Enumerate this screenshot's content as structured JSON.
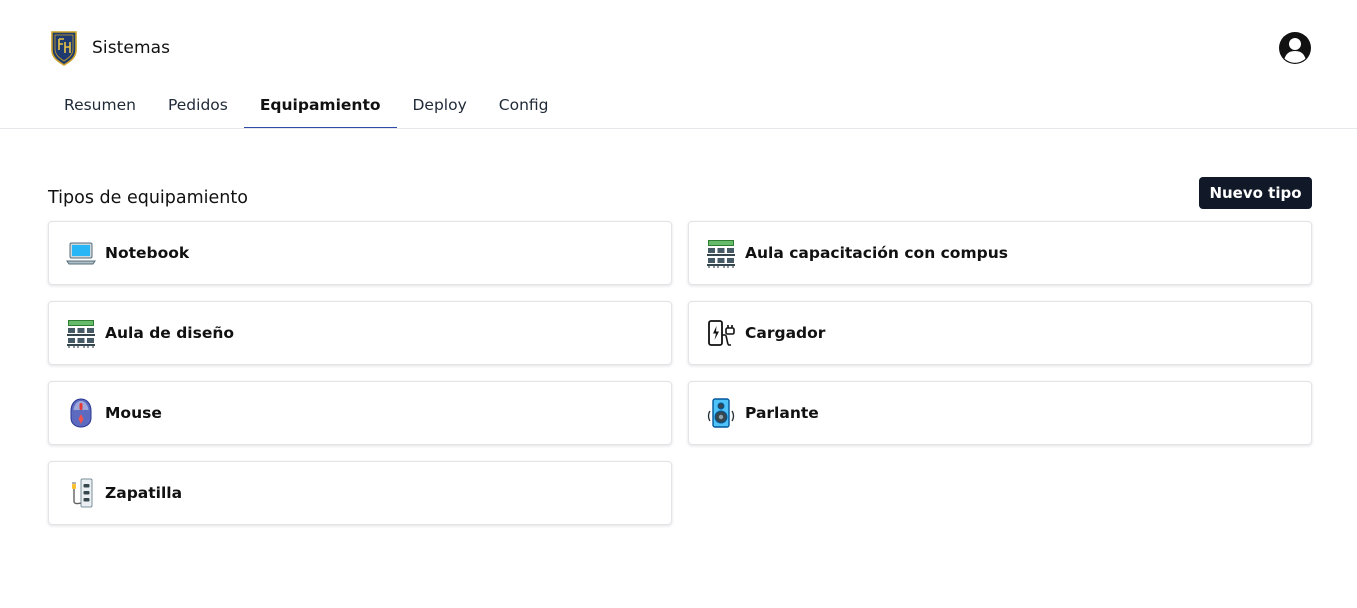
{
  "app": {
    "title": "Sistemas",
    "logo_icon": "school-crest-icon",
    "profile_icon": "user-circle-icon"
  },
  "nav": {
    "tabs": [
      {
        "label": "Resumen",
        "active": false
      },
      {
        "label": "Pedidos",
        "active": false
      },
      {
        "label": "Equipamiento",
        "active": true
      },
      {
        "label": "Deploy",
        "active": false
      },
      {
        "label": "Config",
        "active": false
      }
    ]
  },
  "main": {
    "section_title": "Tipos de equipamiento",
    "new_button_label": "Nuevo tipo",
    "equipment_types": [
      {
        "label": "Notebook",
        "icon": "laptop-icon"
      },
      {
        "label": "Aula capacitación con compus",
        "icon": "classroom-icon"
      },
      {
        "label": "Aula de diseño",
        "icon": "classroom-icon"
      },
      {
        "label": "Cargador",
        "icon": "charger-icon"
      },
      {
        "label": "Mouse",
        "icon": "mouse-icon"
      },
      {
        "label": "Parlante",
        "icon": "speaker-icon"
      },
      {
        "label": "Zapatilla",
        "icon": "power-strip-icon"
      }
    ]
  },
  "colors": {
    "primary_button": "#111827",
    "active_tab_underline": "#2f4aa8",
    "border": "#e2e4e8"
  }
}
